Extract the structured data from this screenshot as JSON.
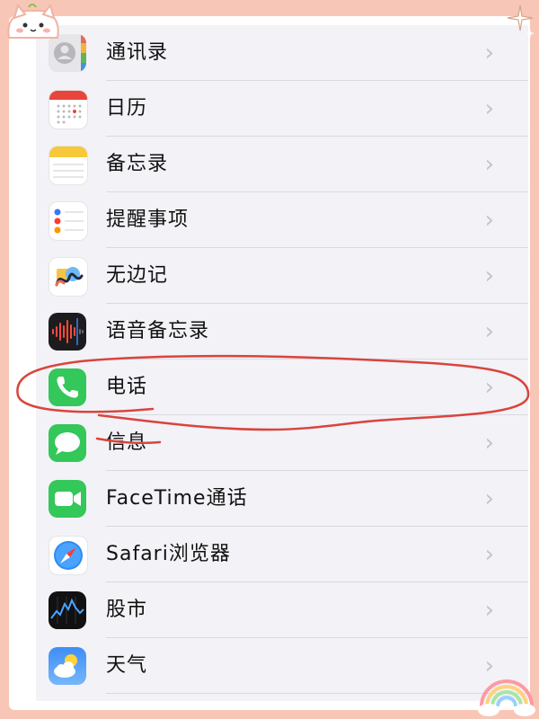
{
  "settings": {
    "items": [
      {
        "label": "通讯录",
        "icon": "contacts-icon"
      },
      {
        "label": "日历",
        "icon": "calendar-icon"
      },
      {
        "label": "备忘录",
        "icon": "notes-icon"
      },
      {
        "label": "提醒事项",
        "icon": "reminders-icon"
      },
      {
        "label": "无边记",
        "icon": "freeform-icon"
      },
      {
        "label": "语音备忘录",
        "icon": "voice-memos-icon"
      },
      {
        "label": "电话",
        "icon": "phone-icon"
      },
      {
        "label": "信息",
        "icon": "messages-icon"
      },
      {
        "label": "FaceTime通话",
        "icon": "facetime-icon"
      },
      {
        "label": "Safari浏览器",
        "icon": "safari-icon"
      },
      {
        "label": "股市",
        "icon": "stocks-icon"
      },
      {
        "label": "天气",
        "icon": "weather-icon"
      }
    ],
    "chevron": "›",
    "highlighted_item": "电话"
  },
  "colors": {
    "page_border": "#f8c6b6",
    "annotation": "#d9443c",
    "phone_green": "#34c759",
    "list_background": "#f2f2f7"
  }
}
